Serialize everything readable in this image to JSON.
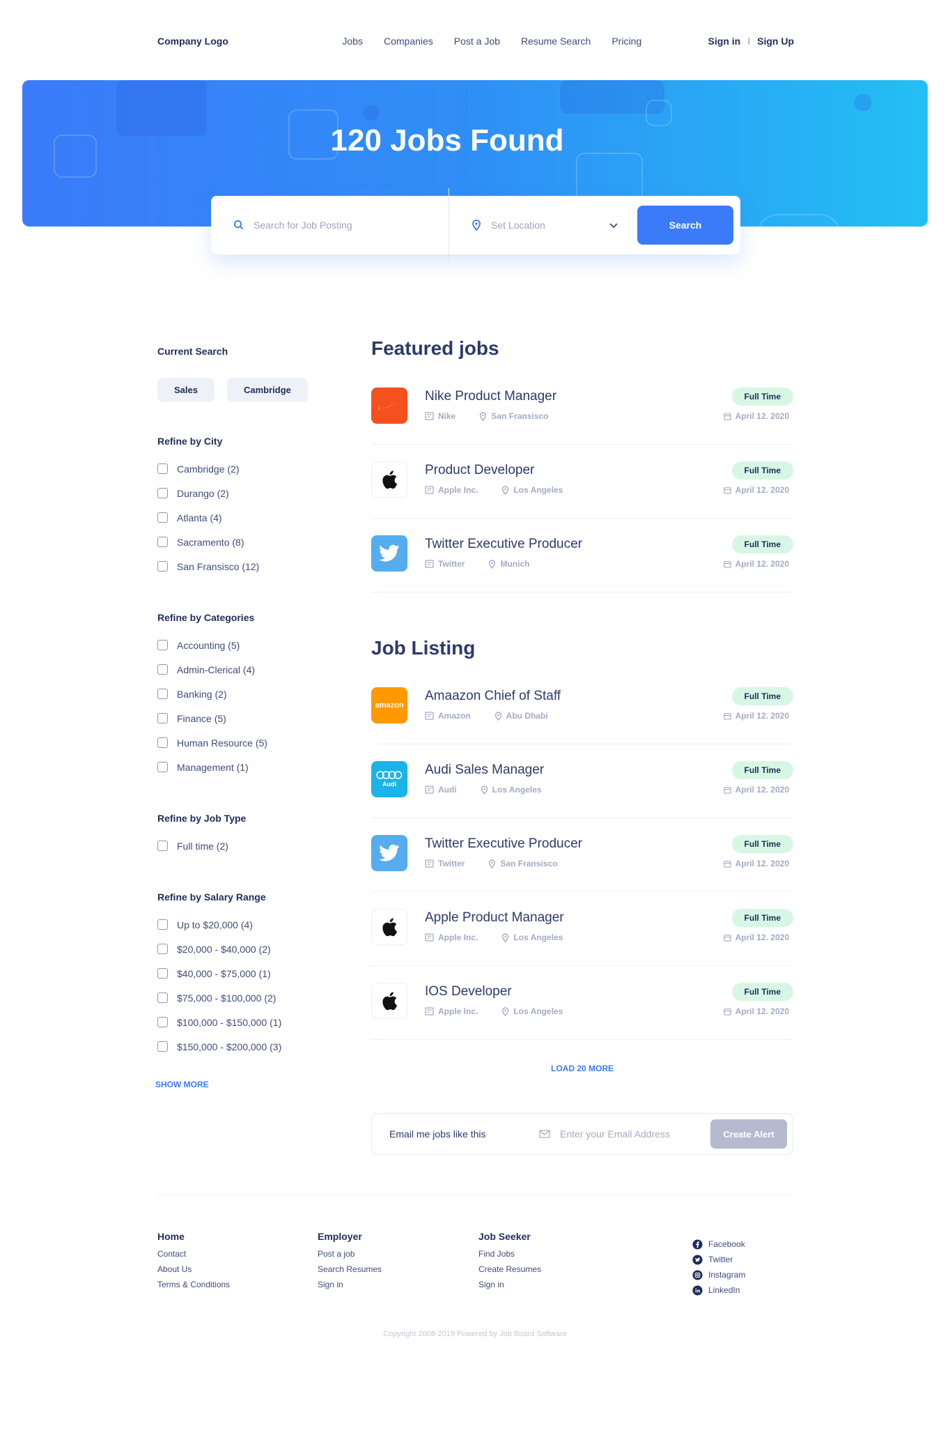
{
  "nav": {
    "logo": "Company Logo",
    "links": [
      "Jobs",
      "Companies",
      "Post a Job",
      "Resume Search",
      "Pricing"
    ],
    "sign_in": "Sign in",
    "sep": "I",
    "sign_up": "Sign Up"
  },
  "hero": {
    "title": "120 Jobs Found",
    "search_placeholder": "Search for Job Posting",
    "location_placeholder": "Set Location",
    "search_button": "Search"
  },
  "sidebar": {
    "current_search_title": "Current Search",
    "chips": [
      "Sales",
      "Cambridge"
    ],
    "city": {
      "title": "Refine by City",
      "items": [
        "Cambridge (2)",
        "Durango (2)",
        "Atlanta (4)",
        "Sacramento (8)",
        "San Fransisco (12)"
      ]
    },
    "categories": {
      "title": "Refine by Categories",
      "items": [
        "Accounting (5)",
        "Admin-Clerical (4)",
        "Banking (2)",
        "Finance (5)",
        "Human Resource (5)",
        "Management (1)"
      ]
    },
    "job_type": {
      "title": "Refine by Job Type",
      "items": [
        "Full time (2)"
      ]
    },
    "salary": {
      "title": "Refine by Salary Range",
      "items": [
        "Up to $20,000 (4)",
        "$20,000 - $40,000 (2)",
        "$40,000 - $75,000 (1)",
        "$75,000 - $100,000 (2)",
        "$100,000 - $150,000 (1)",
        "$150,000 - $200,000 (3)"
      ]
    },
    "show_more": "SHOW MORE"
  },
  "featured": {
    "title": "Featured jobs",
    "jobs": [
      {
        "title": "Nike Product Manager",
        "company": "Nike",
        "location": "San Fransisco",
        "type": "Full Time",
        "date": "April 12. 2020",
        "logo": "nike-logo"
      },
      {
        "title": "Product Developer",
        "company": "Apple Inc.",
        "location": "Los Angeles",
        "type": "Full Time",
        "date": "April 12. 2020",
        "logo": "apple-logo"
      },
      {
        "title": "Twitter Executive Producer",
        "company": "Twitter",
        "location": "Munich",
        "type": "Full Time",
        "date": "April 12. 2020",
        "logo": "twitter-logo"
      }
    ]
  },
  "listing": {
    "title": "Job Listing",
    "jobs": [
      {
        "title": "Amaazon Chief of Staff",
        "company": "Amazon",
        "location": "Abu Dhabi",
        "type": "Full Time",
        "date": "April 12. 2020",
        "logo": "amazon-logo",
        "logo_text": "amazon"
      },
      {
        "title": "Audi Sales Manager",
        "company": "Audi",
        "location": "Los Angeles",
        "type": "Full Time",
        "date": "April 12. 2020",
        "logo": "audi-logo",
        "logo_text": "Audi"
      },
      {
        "title": "Twitter Executive Producer",
        "company": "Twitter",
        "location": "San Fransisco",
        "type": "Full Time",
        "date": "April 12. 2020",
        "logo": "twitter-logo"
      },
      {
        "title": "Apple Product Manager",
        "company": "Apple Inc.",
        "location": "Los Angeles",
        "type": "Full Time",
        "date": "April 12. 2020",
        "logo": "apple-logo"
      },
      {
        "title": "IOS Developer",
        "company": "Apple Inc.",
        "location": "Los Angeles",
        "type": "Full Time",
        "date": "April 12. 2020",
        "logo": "apple-logo"
      }
    ],
    "load_more": "LOAD 20 MORE"
  },
  "alert": {
    "label": "Email me jobs like this",
    "email_placeholder": "Enter your Email Address",
    "button": "Create Alert"
  },
  "footer": {
    "home": {
      "title": "Home",
      "links": [
        "Contact",
        "About Us",
        "Terms & Conditions"
      ]
    },
    "employer": {
      "title": "Employer",
      "links": [
        "Post a job",
        "Search Resumes",
        "Sign in"
      ]
    },
    "seeker": {
      "title": "Job Seeker",
      "links": [
        "Find Jobs",
        "Create Resumes",
        "Sign in"
      ]
    },
    "social": [
      {
        "label": "Facebook",
        "icon": "facebook-icon"
      },
      {
        "label": "Twitter",
        "icon": "twitter-icon"
      },
      {
        "label": "Instagram",
        "icon": "instagram-icon"
      },
      {
        "label": "LinkedIn",
        "icon": "linkedin-icon"
      }
    ],
    "copyright": "Copyright 2008-2019 Powered by Job Board Software"
  },
  "colors": {
    "primary": "#3b7bf9",
    "navy": "#1f2d5a",
    "badge": "#d7f7e4",
    "nike": "#f4511e",
    "amazon": "#ff9900",
    "audi": "#1ab4e8",
    "twitter": "#55acee"
  }
}
